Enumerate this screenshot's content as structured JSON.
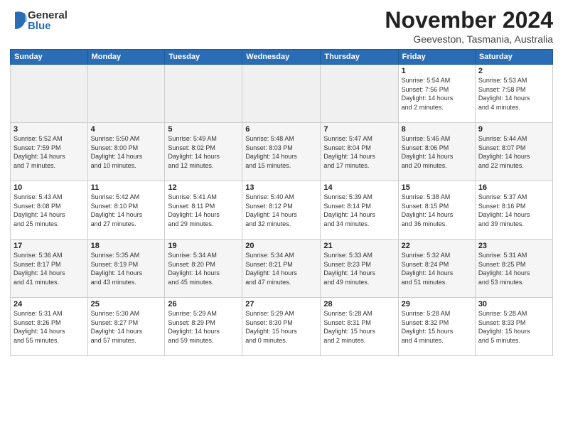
{
  "logo": {
    "general": "General",
    "blue": "Blue"
  },
  "title": "November 2024",
  "subtitle": "Geeveston, Tasmania, Australia",
  "days_of_week": [
    "Sunday",
    "Monday",
    "Tuesday",
    "Wednesday",
    "Thursday",
    "Friday",
    "Saturday"
  ],
  "weeks": [
    [
      {
        "day": "",
        "info": ""
      },
      {
        "day": "",
        "info": ""
      },
      {
        "day": "",
        "info": ""
      },
      {
        "day": "",
        "info": ""
      },
      {
        "day": "",
        "info": ""
      },
      {
        "day": "1",
        "info": "Sunrise: 5:54 AM\nSunset: 7:56 PM\nDaylight: 14 hours\nand 2 minutes."
      },
      {
        "day": "2",
        "info": "Sunrise: 5:53 AM\nSunset: 7:58 PM\nDaylight: 14 hours\nand 4 minutes."
      }
    ],
    [
      {
        "day": "3",
        "info": "Sunrise: 5:52 AM\nSunset: 7:59 PM\nDaylight: 14 hours\nand 7 minutes."
      },
      {
        "day": "4",
        "info": "Sunrise: 5:50 AM\nSunset: 8:00 PM\nDaylight: 14 hours\nand 10 minutes."
      },
      {
        "day": "5",
        "info": "Sunrise: 5:49 AM\nSunset: 8:02 PM\nDaylight: 14 hours\nand 12 minutes."
      },
      {
        "day": "6",
        "info": "Sunrise: 5:48 AM\nSunset: 8:03 PM\nDaylight: 14 hours\nand 15 minutes."
      },
      {
        "day": "7",
        "info": "Sunrise: 5:47 AM\nSunset: 8:04 PM\nDaylight: 14 hours\nand 17 minutes."
      },
      {
        "day": "8",
        "info": "Sunrise: 5:45 AM\nSunset: 8:06 PM\nDaylight: 14 hours\nand 20 minutes."
      },
      {
        "day": "9",
        "info": "Sunrise: 5:44 AM\nSunset: 8:07 PM\nDaylight: 14 hours\nand 22 minutes."
      }
    ],
    [
      {
        "day": "10",
        "info": "Sunrise: 5:43 AM\nSunset: 8:08 PM\nDaylight: 14 hours\nand 25 minutes."
      },
      {
        "day": "11",
        "info": "Sunrise: 5:42 AM\nSunset: 8:10 PM\nDaylight: 14 hours\nand 27 minutes."
      },
      {
        "day": "12",
        "info": "Sunrise: 5:41 AM\nSunset: 8:11 PM\nDaylight: 14 hours\nand 29 minutes."
      },
      {
        "day": "13",
        "info": "Sunrise: 5:40 AM\nSunset: 8:12 PM\nDaylight: 14 hours\nand 32 minutes."
      },
      {
        "day": "14",
        "info": "Sunrise: 5:39 AM\nSunset: 8:14 PM\nDaylight: 14 hours\nand 34 minutes."
      },
      {
        "day": "15",
        "info": "Sunrise: 5:38 AM\nSunset: 8:15 PM\nDaylight: 14 hours\nand 36 minutes."
      },
      {
        "day": "16",
        "info": "Sunrise: 5:37 AM\nSunset: 8:16 PM\nDaylight: 14 hours\nand 39 minutes."
      }
    ],
    [
      {
        "day": "17",
        "info": "Sunrise: 5:36 AM\nSunset: 8:17 PM\nDaylight: 14 hours\nand 41 minutes."
      },
      {
        "day": "18",
        "info": "Sunrise: 5:35 AM\nSunset: 8:19 PM\nDaylight: 14 hours\nand 43 minutes."
      },
      {
        "day": "19",
        "info": "Sunrise: 5:34 AM\nSunset: 8:20 PM\nDaylight: 14 hours\nand 45 minutes."
      },
      {
        "day": "20",
        "info": "Sunrise: 5:34 AM\nSunset: 8:21 PM\nDaylight: 14 hours\nand 47 minutes."
      },
      {
        "day": "21",
        "info": "Sunrise: 5:33 AM\nSunset: 8:23 PM\nDaylight: 14 hours\nand 49 minutes."
      },
      {
        "day": "22",
        "info": "Sunrise: 5:32 AM\nSunset: 8:24 PM\nDaylight: 14 hours\nand 51 minutes."
      },
      {
        "day": "23",
        "info": "Sunrise: 5:31 AM\nSunset: 8:25 PM\nDaylight: 14 hours\nand 53 minutes."
      }
    ],
    [
      {
        "day": "24",
        "info": "Sunrise: 5:31 AM\nSunset: 8:26 PM\nDaylight: 14 hours\nand 55 minutes."
      },
      {
        "day": "25",
        "info": "Sunrise: 5:30 AM\nSunset: 8:27 PM\nDaylight: 14 hours\nand 57 minutes."
      },
      {
        "day": "26",
        "info": "Sunrise: 5:29 AM\nSunset: 8:29 PM\nDaylight: 14 hours\nand 59 minutes."
      },
      {
        "day": "27",
        "info": "Sunrise: 5:29 AM\nSunset: 8:30 PM\nDaylight: 15 hours\nand 0 minutes."
      },
      {
        "day": "28",
        "info": "Sunrise: 5:28 AM\nSunset: 8:31 PM\nDaylight: 15 hours\nand 2 minutes."
      },
      {
        "day": "29",
        "info": "Sunrise: 5:28 AM\nSunset: 8:32 PM\nDaylight: 15 hours\nand 4 minutes."
      },
      {
        "day": "30",
        "info": "Sunrise: 5:28 AM\nSunset: 8:33 PM\nDaylight: 15 hours\nand 5 minutes."
      }
    ]
  ]
}
